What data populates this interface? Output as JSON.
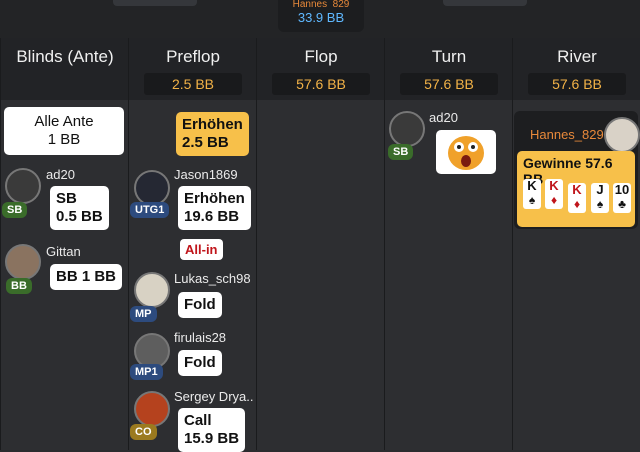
{
  "winner_chip": {
    "name": "Hannes_829",
    "pot": "33.9 BB"
  },
  "columns": [
    {
      "title": "Blinds (Ante)",
      "amount": ""
    },
    {
      "title": "Preflop",
      "amount": "2.5 BB"
    },
    {
      "title": "Flop",
      "amount": "57.6 BB"
    },
    {
      "title": "Turn",
      "amount": "57.6 BB"
    },
    {
      "title": "River",
      "amount": "57.6 BB"
    }
  ],
  "blinds": {
    "ante": {
      "line1": "Alle Ante",
      "line2": "1 BB"
    },
    "players": [
      {
        "name": "ad20",
        "pos": "SB",
        "action1": "SB",
        "action2": "0.5 BB"
      },
      {
        "name": "Gittan",
        "pos": "BB",
        "action1": "BB 1 BB",
        "action2": ""
      }
    ]
  },
  "preflop": {
    "raise": {
      "line1": "Erhöhen",
      "line2": "2.5 BB"
    },
    "players": [
      {
        "name": "Jason1869",
        "pos": "UTG1",
        "action1": "Erhöhen",
        "action2": "19.6 BB",
        "tag": "All-in"
      },
      {
        "name": "Lukas_sch98",
        "pos": "MP",
        "action1": "Fold",
        "action2": ""
      },
      {
        "name": "firulais28",
        "pos": "MP1",
        "action1": "Fold",
        "action2": ""
      },
      {
        "name": "Sergey Drya..",
        "pos": "CO",
        "action1": "Call",
        "action2": "15.9 BB"
      }
    ]
  },
  "turn": {
    "name": "ad20",
    "pos": "SB"
  },
  "river": {
    "name": "Hannes_829",
    "win_label": "Gewinne 57.6 BB",
    "cards": [
      {
        "rank": "K",
        "suit": "♠"
      },
      {
        "rank": "K",
        "suit": "♦"
      },
      {
        "rank": "K",
        "suit": "♦"
      },
      {
        "rank": "J",
        "suit": "♠"
      },
      {
        "rank": "10",
        "suit": "♣"
      }
    ]
  },
  "colors": {
    "accent": "#f2b247",
    "pot": "#5fb8ff",
    "name_orange": "#e8893a",
    "allin_red": "#c0151b"
  }
}
